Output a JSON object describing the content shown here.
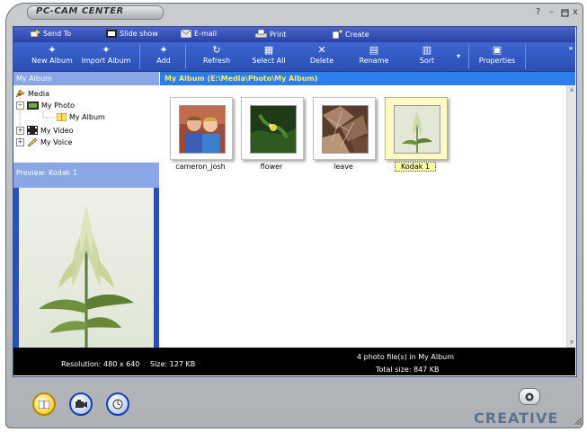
{
  "app": {
    "title": "PC-CAM CENTER",
    "logo": "CREATIVE"
  },
  "window_controls": {
    "help": "?",
    "minimize": "–",
    "restore": "▫",
    "close": "x"
  },
  "menu": [
    {
      "label": "Send To",
      "icon": "send-icon"
    },
    {
      "label": "Slide show",
      "icon": "slideshow-icon"
    },
    {
      "label": "E-mail",
      "icon": "email-icon"
    },
    {
      "label": "Print",
      "icon": "print-icon"
    },
    {
      "label": "Create",
      "icon": "create-icon"
    }
  ],
  "toolbar": {
    "new_album": "New Album",
    "import_album": "Import Album",
    "add": "Add",
    "refresh": "Refresh",
    "select_all": "Select All",
    "delete": "Delete",
    "rename": "Rename",
    "sort": "Sort",
    "properties": "Properties",
    "more": "»"
  },
  "left_panel": {
    "header": "My Album",
    "tree": {
      "root": "Media",
      "my_photo": "My Photo",
      "my_album": "My Album",
      "my_video": "My Video",
      "my_voice": "My Voice"
    },
    "preview_header": "Preview: Kodak 1"
  },
  "content": {
    "header": "My Album   (E:\\Media\\Photo\\My Album)",
    "items": [
      {
        "label": "cameron_josh",
        "selected": false
      },
      {
        "label": "flower",
        "selected": false
      },
      {
        "label": "leave",
        "selected": false
      },
      {
        "label": "Kodak 1",
        "selected": true
      }
    ]
  },
  "status": {
    "resolution": "Resolution: 480 x 640",
    "size": "Size: 127 KB",
    "count": "4 photo file(s) in My Album",
    "total": "Total size: 847 KB"
  },
  "colors": {
    "toolbar_blue": "#2a4fb5",
    "header_blue": "#2c7ee8",
    "panel_light_blue": "#8aa6e6",
    "path_yellow": "#ffeb6b",
    "selected_bg": "#fff9c6"
  }
}
